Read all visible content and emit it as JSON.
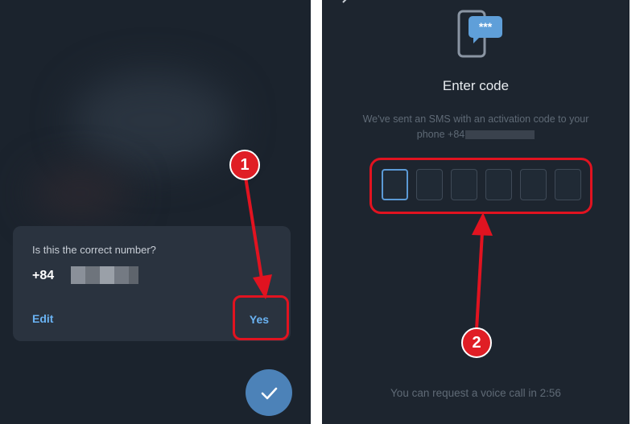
{
  "left_panel": {
    "dialog": {
      "question": "Is this the correct number?",
      "phone_prefix": "+84",
      "edit_label": "Edit",
      "yes_label": "Yes"
    },
    "fab_icon": "check-icon"
  },
  "right_panel": {
    "icon": "sms-phone-icon",
    "title": "Enter code",
    "subtitle_line1": "We've sent an SMS with an activation code to your",
    "subtitle_line2": "phone +84",
    "code_boxes": [
      "",
      "",
      "",
      "",
      "",
      ""
    ],
    "voice_call_text": "You can request a voice call in 2:56"
  },
  "annotations": {
    "step1": "1",
    "step2": "2",
    "highlight_color": "#e11320"
  },
  "colors": {
    "accent": "#6ab3f3",
    "background": "#1b232d",
    "fab": "#4c82b8"
  }
}
